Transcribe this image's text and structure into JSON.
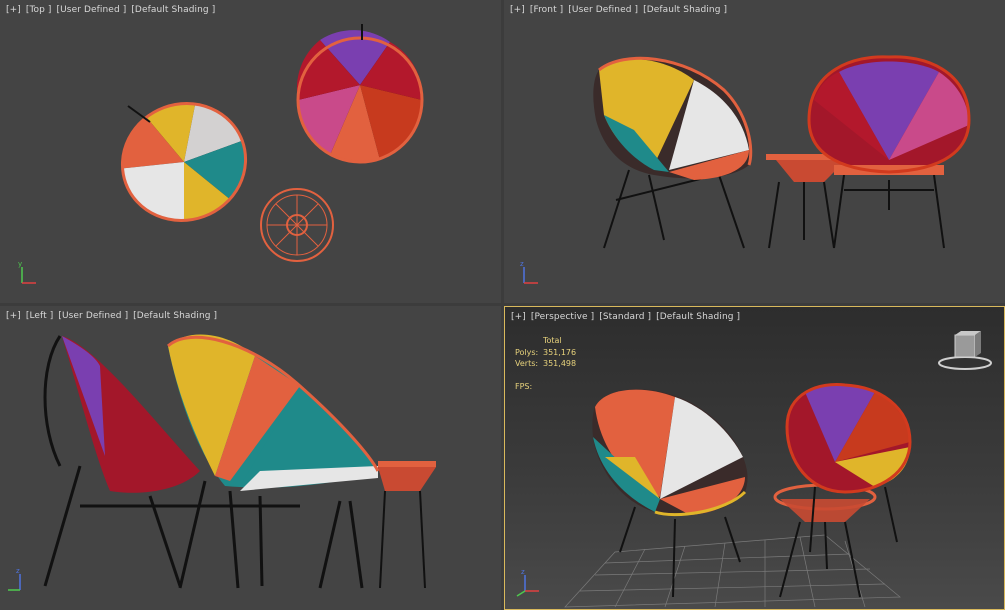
{
  "viewports": {
    "top": {
      "plus": "[+]",
      "name": "[Top ]",
      "view": "[User Defined ]",
      "shading": "[Default Shading ]"
    },
    "front": {
      "plus": "[+]",
      "name": "[Front ]",
      "view": "[User Defined ]",
      "shading": "[Default Shading ]"
    },
    "left": {
      "plus": "[+]",
      "name": "[Left ]",
      "view": "[User Defined ]",
      "shading": "[Default Shading ]"
    },
    "perspective": {
      "plus": "[+]",
      "name": "[Perspective ]",
      "view": "[Standard ]",
      "shading": "[Default Shading ]"
    }
  },
  "stats": {
    "header": "Total",
    "polys_label": "Polys:",
    "polys_value": "351,176",
    "verts_label": "Verts:",
    "verts_value": "351,498",
    "fps_label": "FPS:"
  },
  "axis_labels": {
    "x": "x",
    "y": "y",
    "z": "z"
  },
  "colors": {
    "viewport_bg": "#444444",
    "active_border": "#d9b95c",
    "stats_text": "#e7d27c",
    "cord_orange": "#e2613f",
    "cord_yellow": "#e0b52a",
    "cord_white": "#e6e6e6",
    "cord_teal": "#1f8a8a",
    "cord_purple": "#7a3fb0",
    "cord_red": "#b3182c",
    "cord_pink": "#c94a8a",
    "frame": "#111111"
  },
  "icons": {
    "viewcube": "viewcube-icon",
    "axis_tripod": "axis-tripod-icon"
  }
}
